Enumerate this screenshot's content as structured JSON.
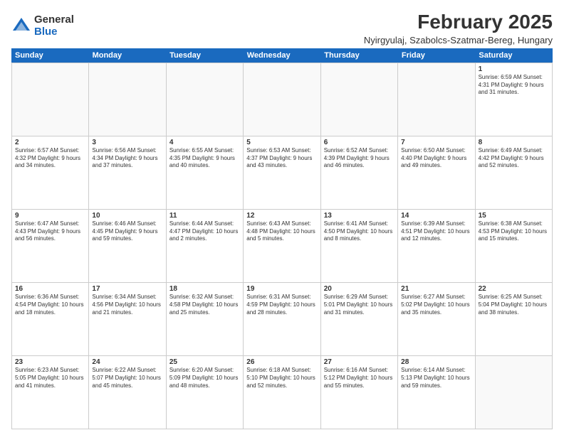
{
  "logo": {
    "general": "General",
    "blue": "Blue"
  },
  "title": "February 2025",
  "subtitle": "Nyirgyulaj, Szabolcs-Szatmar-Bereg, Hungary",
  "header": {
    "days": [
      "Sunday",
      "Monday",
      "Tuesday",
      "Wednesday",
      "Thursday",
      "Friday",
      "Saturday"
    ]
  },
  "weeks": [
    [
      {
        "day": "",
        "info": ""
      },
      {
        "day": "",
        "info": ""
      },
      {
        "day": "",
        "info": ""
      },
      {
        "day": "",
        "info": ""
      },
      {
        "day": "",
        "info": ""
      },
      {
        "day": "",
        "info": ""
      },
      {
        "day": "1",
        "info": "Sunrise: 6:59 AM\nSunset: 4:31 PM\nDaylight: 9 hours and 31 minutes."
      }
    ],
    [
      {
        "day": "2",
        "info": "Sunrise: 6:57 AM\nSunset: 4:32 PM\nDaylight: 9 hours and 34 minutes."
      },
      {
        "day": "3",
        "info": "Sunrise: 6:56 AM\nSunset: 4:34 PM\nDaylight: 9 hours and 37 minutes."
      },
      {
        "day": "4",
        "info": "Sunrise: 6:55 AM\nSunset: 4:35 PM\nDaylight: 9 hours and 40 minutes."
      },
      {
        "day": "5",
        "info": "Sunrise: 6:53 AM\nSunset: 4:37 PM\nDaylight: 9 hours and 43 minutes."
      },
      {
        "day": "6",
        "info": "Sunrise: 6:52 AM\nSunset: 4:39 PM\nDaylight: 9 hours and 46 minutes."
      },
      {
        "day": "7",
        "info": "Sunrise: 6:50 AM\nSunset: 4:40 PM\nDaylight: 9 hours and 49 minutes."
      },
      {
        "day": "8",
        "info": "Sunrise: 6:49 AM\nSunset: 4:42 PM\nDaylight: 9 hours and 52 minutes."
      }
    ],
    [
      {
        "day": "9",
        "info": "Sunrise: 6:47 AM\nSunset: 4:43 PM\nDaylight: 9 hours and 56 minutes."
      },
      {
        "day": "10",
        "info": "Sunrise: 6:46 AM\nSunset: 4:45 PM\nDaylight: 9 hours and 59 minutes."
      },
      {
        "day": "11",
        "info": "Sunrise: 6:44 AM\nSunset: 4:47 PM\nDaylight: 10 hours and 2 minutes."
      },
      {
        "day": "12",
        "info": "Sunrise: 6:43 AM\nSunset: 4:48 PM\nDaylight: 10 hours and 5 minutes."
      },
      {
        "day": "13",
        "info": "Sunrise: 6:41 AM\nSunset: 4:50 PM\nDaylight: 10 hours and 8 minutes."
      },
      {
        "day": "14",
        "info": "Sunrise: 6:39 AM\nSunset: 4:51 PM\nDaylight: 10 hours and 12 minutes."
      },
      {
        "day": "15",
        "info": "Sunrise: 6:38 AM\nSunset: 4:53 PM\nDaylight: 10 hours and 15 minutes."
      }
    ],
    [
      {
        "day": "16",
        "info": "Sunrise: 6:36 AM\nSunset: 4:54 PM\nDaylight: 10 hours and 18 minutes."
      },
      {
        "day": "17",
        "info": "Sunrise: 6:34 AM\nSunset: 4:56 PM\nDaylight: 10 hours and 21 minutes."
      },
      {
        "day": "18",
        "info": "Sunrise: 6:32 AM\nSunset: 4:58 PM\nDaylight: 10 hours and 25 minutes."
      },
      {
        "day": "19",
        "info": "Sunrise: 6:31 AM\nSunset: 4:59 PM\nDaylight: 10 hours and 28 minutes."
      },
      {
        "day": "20",
        "info": "Sunrise: 6:29 AM\nSunset: 5:01 PM\nDaylight: 10 hours and 31 minutes."
      },
      {
        "day": "21",
        "info": "Sunrise: 6:27 AM\nSunset: 5:02 PM\nDaylight: 10 hours and 35 minutes."
      },
      {
        "day": "22",
        "info": "Sunrise: 6:25 AM\nSunset: 5:04 PM\nDaylight: 10 hours and 38 minutes."
      }
    ],
    [
      {
        "day": "23",
        "info": "Sunrise: 6:23 AM\nSunset: 5:05 PM\nDaylight: 10 hours and 41 minutes."
      },
      {
        "day": "24",
        "info": "Sunrise: 6:22 AM\nSunset: 5:07 PM\nDaylight: 10 hours and 45 minutes."
      },
      {
        "day": "25",
        "info": "Sunrise: 6:20 AM\nSunset: 5:09 PM\nDaylight: 10 hours and 48 minutes."
      },
      {
        "day": "26",
        "info": "Sunrise: 6:18 AM\nSunset: 5:10 PM\nDaylight: 10 hours and 52 minutes."
      },
      {
        "day": "27",
        "info": "Sunrise: 6:16 AM\nSunset: 5:12 PM\nDaylight: 10 hours and 55 minutes."
      },
      {
        "day": "28",
        "info": "Sunrise: 6:14 AM\nSunset: 5:13 PM\nDaylight: 10 hours and 59 minutes."
      },
      {
        "day": "",
        "info": ""
      }
    ]
  ]
}
